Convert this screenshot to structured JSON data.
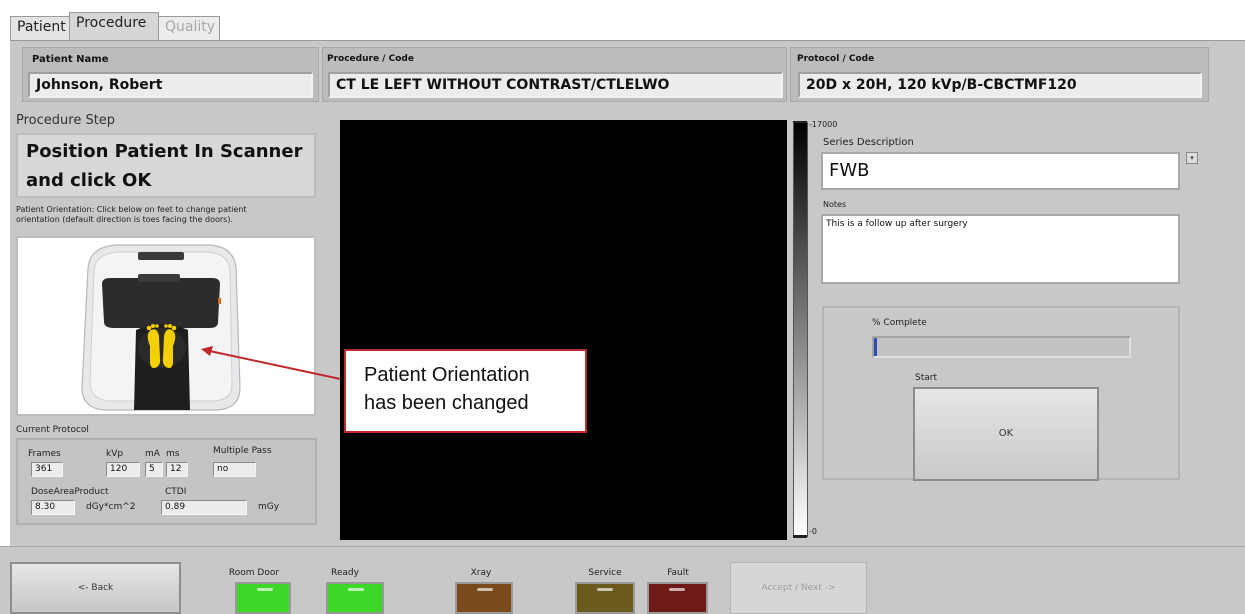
{
  "tabs": [
    {
      "label": "Patient",
      "state": "normal"
    },
    {
      "label": "Procedure",
      "state": "active"
    },
    {
      "label": "Quality",
      "state": "disabled"
    }
  ],
  "header": {
    "patient_name_label": "Patient Name",
    "patient_name": "Johnson, Robert",
    "procedure_label": "Procedure / Code",
    "procedure": "CT LE LEFT WITHOUT CONTRAST/CTLELWO",
    "protocol_label": "Protocol / Code",
    "protocol": "20D x 20H, 120 kVp/B-CBCTMF120"
  },
  "procedure_step": {
    "label": "Procedure Step",
    "line1": "Position Patient In Scanner",
    "line2": "and click OK"
  },
  "orientation": {
    "note_line1": "Patient Orientation: Click below on feet to change patient",
    "note_line2": "orientation (default direction is toes facing the doors)."
  },
  "current_protocol": {
    "label": "Current Protocol",
    "frames_label": "Frames",
    "frames": "361",
    "kvp_label": "kVp",
    "kvp": "120",
    "ma_label": "mA",
    "ma": "5",
    "ms_label": "ms",
    "ms": "12",
    "multipass_label": "Multiple Pass",
    "multipass": "no",
    "dap_label": "DoseAreaProduct",
    "dap": "8.30",
    "dap_unit": "dGy*cm^2",
    "ctdi_label": "CTDI",
    "ctdi": "0.89",
    "ctdi_unit": "mGy"
  },
  "scale": {
    "max": "17000",
    "min": "0"
  },
  "series": {
    "label": "Series Description",
    "value": "FWB",
    "dropdown_glyph": "▾"
  },
  "notes": {
    "label": "Notes",
    "value": "This is a follow up after surgery"
  },
  "progress": {
    "label": "% Complete",
    "percent": 1
  },
  "start": {
    "label": "Start",
    "ok_label": "OK"
  },
  "callout": {
    "line1": "Patient Orientation",
    "line2": "has been changed"
  },
  "bottom": {
    "back_label": "<- Back",
    "accept_label": "Accept / Next ->",
    "indicators": [
      {
        "label": "Room Door",
        "color": "#3fd62a"
      },
      {
        "label": "Ready",
        "color": "#3fd62a"
      },
      {
        "label": "Xray",
        "color": "#7a4a1c"
      },
      {
        "label": "Service",
        "color": "#6a5a1e"
      },
      {
        "label": "Fault",
        "color": "#6e1a16"
      }
    ]
  },
  "colors": {
    "accent_red": "#c0282c",
    "feet_yellow": "#f5d000"
  }
}
